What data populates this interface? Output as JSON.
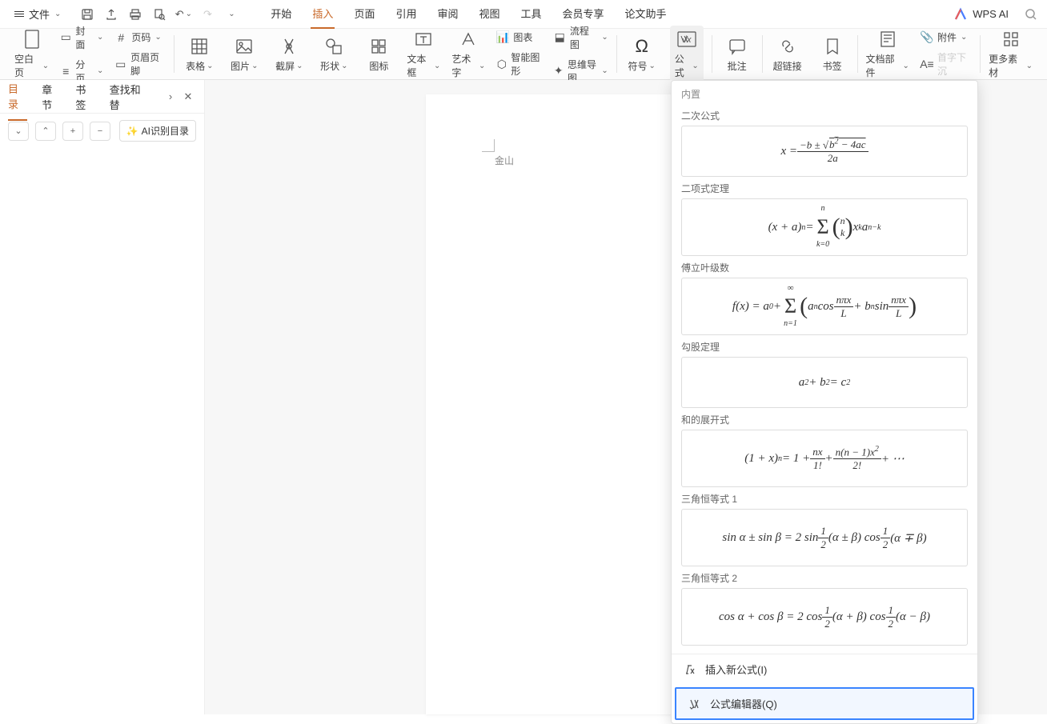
{
  "file_menu": "文件",
  "wps_ai": "WPS AI",
  "tabs": {
    "start": "开始",
    "insert": "插入",
    "page": "页面",
    "reference": "引用",
    "review": "审阅",
    "view": "视图",
    "tools": "工具",
    "member": "会员专享",
    "thesis": "论文助手"
  },
  "ribbon": {
    "blank_page": "空白页",
    "cover": "封面",
    "pagenum": "页码",
    "pagebreak": "分页",
    "header_footer": "页眉页脚",
    "table": "表格",
    "picture": "图片",
    "screenshot": "截屏",
    "shapes": "形状",
    "icons": "图标",
    "textbox": "文本框",
    "wordart": "艺术字",
    "chart": "图表",
    "flowchart": "流程图",
    "smartart": "智能图形",
    "mindmap": "思维导图",
    "symbol": "符号",
    "formula": "公式",
    "comment": "批注",
    "hyperlink": "超链接",
    "bookmark": "书签",
    "docparts": "文档部件",
    "dropcap": "首字下沉",
    "attachment": "附件",
    "more": "更多素材"
  },
  "left_panel": {
    "tabs": {
      "toc": "目录",
      "chapter": "章节",
      "bookmark": "书签",
      "findrepl": "查找和替"
    },
    "ai_toc": "AI识别目录"
  },
  "page_label": "金山",
  "dropdown": {
    "section_builtin": "内置",
    "items": [
      {
        "title": "二次公式"
      },
      {
        "title": "二项式定理"
      },
      {
        "title": "傅立叶级数"
      },
      {
        "title": "勾股定理"
      },
      {
        "title": "和的展开式"
      },
      {
        "title": "三角恒等式 1"
      },
      {
        "title": "三角恒等式 2"
      }
    ],
    "opt_insert": "插入新公式(I)",
    "opt_editor": "公式编辑器(Q)"
  }
}
